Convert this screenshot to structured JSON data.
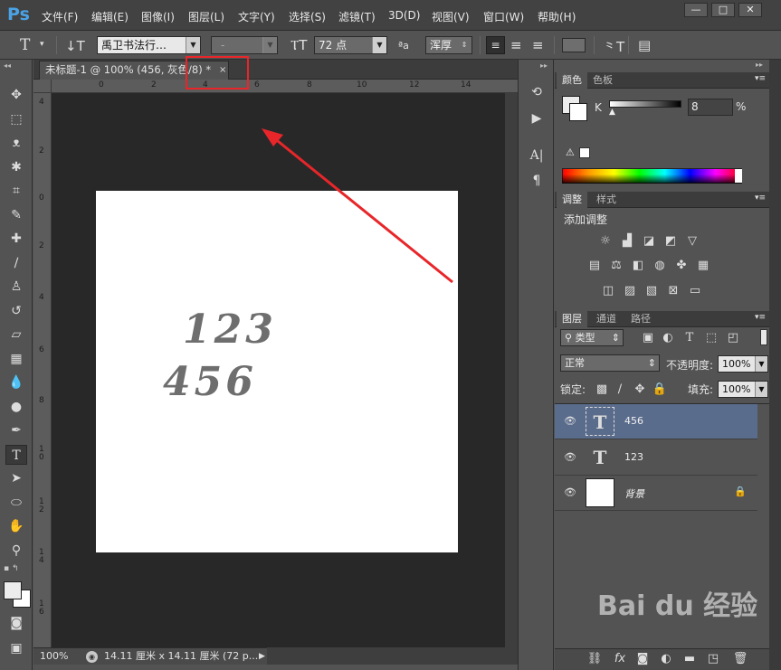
{
  "app": {
    "logo": "Ps",
    "window_controls": [
      "—",
      "□",
      "✕"
    ]
  },
  "menu": [
    "文件(F)",
    "编辑(E)",
    "图像(I)",
    "图层(L)",
    "文字(Y)",
    "选择(S)",
    "滤镜(T)",
    "3D(D)",
    "视图(V)",
    "窗口(W)",
    "帮助(H)"
  ],
  "options": {
    "tool_glyph": "T",
    "font_family": "禹卫书法行…",
    "font_style": "-",
    "font_size": "72 点",
    "aa_label": "ªa",
    "antialias": "浑厚"
  },
  "document": {
    "tab_title": "未标题-1 @ 100% (456, 灰色/8) *",
    "close": "×",
    "ruler_top": [
      "0",
      "2",
      "4",
      "6",
      "8",
      "10",
      "12",
      "14"
    ],
    "ruler_left": [
      "4",
      "2",
      "0",
      "2",
      "4",
      "6",
      "8",
      "1\n0",
      "1\n2",
      "1\n4",
      "1\n6"
    ],
    "canvas_text": [
      "123",
      "456"
    ],
    "zoom": "100%",
    "doc_info": "14.11 厘米 x 14.11 厘米 (72 p..."
  },
  "color_panel": {
    "tabs": [
      "颜色",
      "色板"
    ],
    "channel": "K",
    "value": "8",
    "unit": "%"
  },
  "adjust_panel": {
    "tabs": [
      "调整",
      "样式"
    ],
    "title": "添加调整"
  },
  "layers_panel": {
    "tabs": [
      "图层",
      "通道",
      "路径"
    ],
    "filter": "类型",
    "blend_mode": "正常",
    "opacity_label": "不透明度:",
    "opacity": "100%",
    "lock_label": "锁定:",
    "fill_label": "填充:",
    "fill": "100%",
    "layers": [
      {
        "name": "456",
        "thumb": "T",
        "selected": true
      },
      {
        "name": "123",
        "thumb": "T",
        "selected": false
      },
      {
        "name": "背景",
        "thumb": "",
        "selected": false
      }
    ]
  },
  "watermark": "Bai du 经验"
}
